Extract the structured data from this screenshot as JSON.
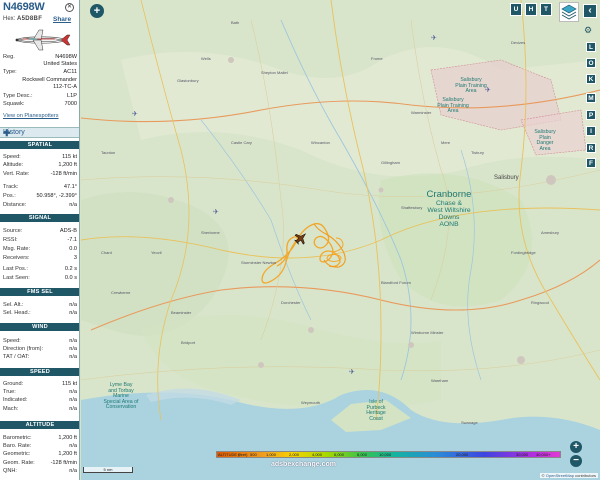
{
  "aircraft": {
    "callsign": "N4698W",
    "hex_label": "Hex:",
    "hex": "A5D8BF",
    "share": "Share",
    "reg_label": "Reg.",
    "reg": "N4698W",
    "country": "United States",
    "type_label": "Type:",
    "type": "AC11",
    "model_line1": "Rockwell Commander",
    "model_line2": "112-TC-A",
    "type_desc_label": "Type Desc.:",
    "type_desc": "L1P",
    "squawk_label": "Squawk:",
    "squawk": "7000",
    "planespotters_link": "View on Planespotters"
  },
  "history_label": "History",
  "sections": {
    "spatial": "SPATIAL",
    "signal": "SIGNAL",
    "fms": "FMS SEL",
    "wind": "WIND",
    "speed": "SPEED",
    "altitude": "ALTITUDE"
  },
  "spatial": [
    {
      "k": "Speed:",
      "v": "115 kt"
    },
    {
      "k": "Altitude:",
      "v": "1,200 ft"
    },
    {
      "k": "Vert. Rate:",
      "v": "-128 ft/min"
    },
    {
      "k": "Track:",
      "v": "47.1°"
    },
    {
      "k": "Pos.:",
      "v": "50.958°, -2.399°"
    },
    {
      "k": "Distance:",
      "v": "n/a"
    }
  ],
  "signal": [
    {
      "k": "Source:",
      "v": "ADS-B"
    },
    {
      "k": "RSSI:",
      "v": "-7.1"
    },
    {
      "k": "Msg. Rate:",
      "v": "0.0"
    },
    {
      "k": "Receivers:",
      "v": "3"
    },
    {
      "k": "Last Pos.:",
      "v": "0.2 s"
    },
    {
      "k": "Last Seen:",
      "v": "0.0 s"
    }
  ],
  "fms": [
    {
      "k": "Sel. Alt.:",
      "v": "n/a"
    },
    {
      "k": "Sel. Head.:",
      "v": "n/a"
    }
  ],
  "wind": [
    {
      "k": "Speed:",
      "v": "n/a"
    },
    {
      "k": "Direction (from):",
      "v": "n/a"
    },
    {
      "k": "TAT / OAT:",
      "v": "n/a"
    }
  ],
  "speed": [
    {
      "k": "Ground:",
      "v": "115 kt"
    },
    {
      "k": "True:",
      "v": "n/a"
    },
    {
      "k": "Indicated:",
      "v": "n/a"
    },
    {
      "k": "Mach:",
      "v": "n/a"
    }
  ],
  "altitude": [
    {
      "k": "Barometric:",
      "v": "1,200 ft"
    },
    {
      "k": "Baro. Rate:",
      "v": "n/a"
    },
    {
      "k": "Geometric:",
      "v": "1,200 ft"
    },
    {
      "k": "Geom. Rate:",
      "v": "-128 ft/min"
    },
    {
      "k": "QNH:",
      "v": "n/a"
    }
  ],
  "map": {
    "right_buttons": [
      "L",
      "O",
      "K",
      "M",
      "P",
      "I",
      "R",
      "F"
    ],
    "top_buttons": [
      "U",
      "H",
      "T"
    ],
    "aonb_main": [
      "Cranborne",
      "Chase &",
      "West Wiltshire",
      "Downs",
      "AONB"
    ],
    "aonb_small": [
      "Salisbury",
      "Plain Training",
      "Area"
    ],
    "aonb_small2": [
      "Salisbury",
      "Plain Training",
      "Area"
    ],
    "aonb_small3": [
      "Salisbury",
      "Plain",
      "Danger",
      "Area"
    ],
    "aonb_coast": [
      "Lyme Bay",
      "and Torbay",
      "Marine",
      "Special Area of",
      "Conservation"
    ],
    "aonb_purbeck": [
      "Isle of",
      "Purbeck",
      "Heritage",
      "Coast"
    ],
    "city_salisbury": "Salisbury",
    "scale_text": "5 nm",
    "attribution_text": "© ",
    "attribution_link": "OpenStreetMap",
    "attribution_tail": " contributors",
    "watermark": "adsbexchange.com",
    "legend_title": "ALTITUDE (feet)",
    "legend_ticks": [
      "0",
      "500",
      "1,000",
      "2,000",
      "4,000",
      "6,000",
      "8,000",
      "10,000",
      "20,000",
      "30,000",
      "40,000+"
    ],
    "accent": "#1f5767",
    "track_color": "#f2a72a",
    "place_labels": [
      "Wells",
      "Glastonbury",
      "Shepton Mallet",
      "Frome",
      "Warminster",
      "Castle Cary",
      "Wincanton",
      "Gillingham",
      "Shaftesbury",
      "Sherborne",
      "Yeovil",
      "Sturminster Newton",
      "Blandford Forum",
      "Dorchester",
      "Weymouth",
      "Bridport",
      "Wimborne Minster",
      "Wareham",
      "Swanage",
      "Ringwood",
      "Fordingbridge",
      "Tisbury",
      "Mere",
      "Chard",
      "Crewkerne",
      "Beaminster",
      "Taunton",
      "Bath",
      "Devizes",
      "Amesbury"
    ]
  }
}
